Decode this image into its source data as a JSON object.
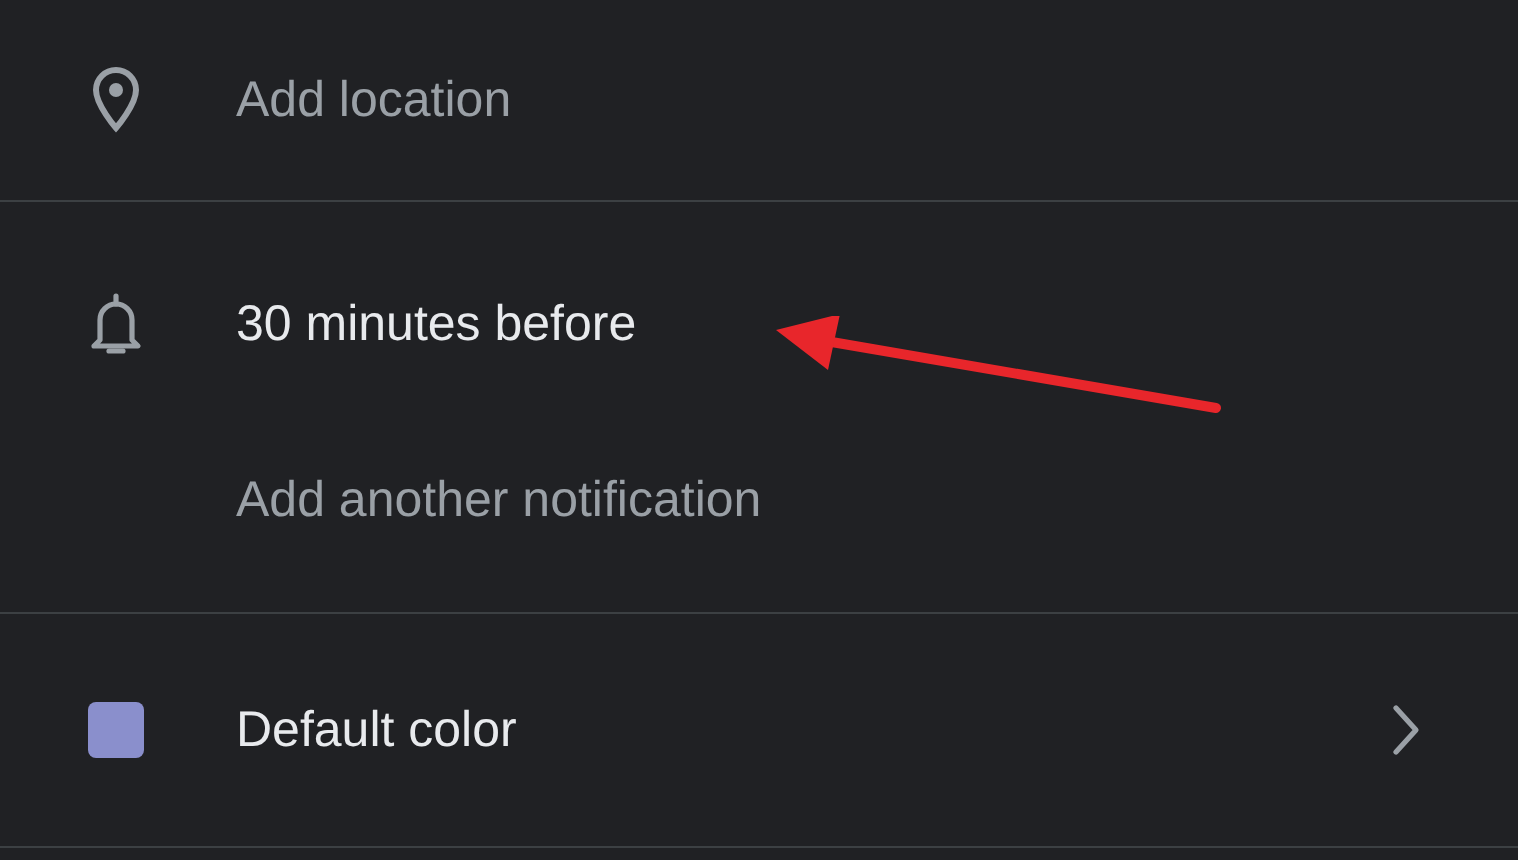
{
  "location": {
    "placeholder": "Add location"
  },
  "notifications": [
    "30 minutes before"
  ],
  "add_notification": "Add another notification",
  "calendar_color": {
    "label": "Default color",
    "color": "#8a8fcc"
  }
}
